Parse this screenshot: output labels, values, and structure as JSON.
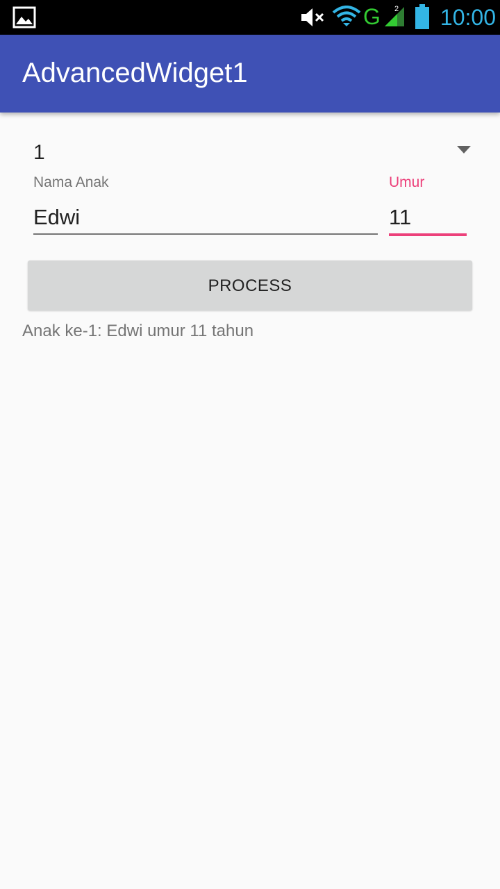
{
  "status_bar": {
    "time": "10:00",
    "network_type": "G",
    "sim_slot": "2",
    "icons": [
      "gallery-icon",
      "mute-icon",
      "wifi-icon",
      "signal-icon",
      "battery-icon"
    ]
  },
  "app_bar": {
    "title": "AdvancedWidget1",
    "color": "#3f51b5"
  },
  "form": {
    "spinner": {
      "selected_value": "1"
    },
    "name_field": {
      "label": "Nama Anak",
      "value": "Edwi"
    },
    "age_field": {
      "label": "Umur",
      "value": "11",
      "focused": true,
      "accent_color": "#ec407a"
    },
    "process_button": {
      "label": "PROCESS"
    }
  },
  "result": {
    "text": "Anak ke-1: Edwi umur 11 tahun"
  }
}
